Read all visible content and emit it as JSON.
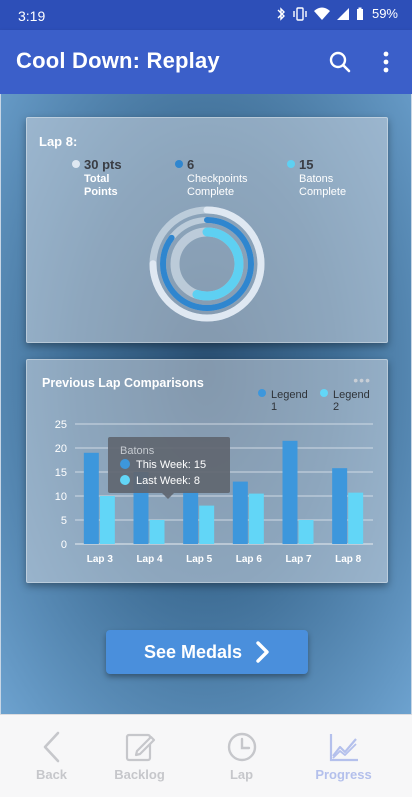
{
  "status": {
    "time": "3:19",
    "battery": "59%"
  },
  "app_bar": {
    "title": "Cool Down: Replay",
    "icons": [
      "search-icon",
      "more-vert-icon"
    ]
  },
  "lap_card": {
    "title": "Lap 8:",
    "stats": [
      {
        "value": "30 pts",
        "label1": "Total",
        "label2": "Points",
        "color": "#dfe8f2"
      },
      {
        "value": "6",
        "label1": "Checkpoints",
        "label2": "Complete",
        "color": "#2f86cf"
      },
      {
        "value": "15",
        "label1": "Batons",
        "label2": "Complete",
        "color": "#5ed0f2"
      }
    ],
    "rings": [
      {
        "name": "Total Points",
        "fraction": 0.75,
        "color": "#dfe8f2"
      },
      {
        "name": "Checkpoints",
        "fraction": 0.85,
        "color": "#2f86cf"
      },
      {
        "name": "Batons",
        "fraction": 0.55,
        "color": "#5ed0f2"
      }
    ]
  },
  "chart_data": {
    "type": "bar",
    "title": "Previous Lap Comparisons",
    "categories": [
      "Lap 3",
      "Lap 4",
      "Lap 5",
      "Lap 6",
      "Lap 7",
      "Lap 8"
    ],
    "series": [
      {
        "name": "Legend 1",
        "values": [
          19,
          15,
          11,
          13,
          21.5,
          15.8
        ],
        "color": "#3d97dc"
      },
      {
        "name": "Legend 2",
        "values": [
          10,
          5,
          8,
          10.5,
          5,
          10.7
        ],
        "color": "#62d6f7"
      }
    ],
    "y_ticks": [
      0,
      5,
      10,
      15,
      20,
      25
    ],
    "ylim": [
      0,
      25
    ],
    "grid": true,
    "legend_position": "top-right",
    "tooltip": {
      "title": "Batons",
      "row1": "This Week: 15",
      "row2": "Last Week: 8"
    }
  },
  "cta": {
    "label": "See Medals"
  },
  "bottom_nav": [
    {
      "label": "Back",
      "icon": "back-icon"
    },
    {
      "label": "Backlog",
      "icon": "edit-icon"
    },
    {
      "label": "Lap",
      "icon": "clock-icon"
    },
    {
      "label": "Progress",
      "icon": "chart-icon",
      "active": true
    }
  ]
}
